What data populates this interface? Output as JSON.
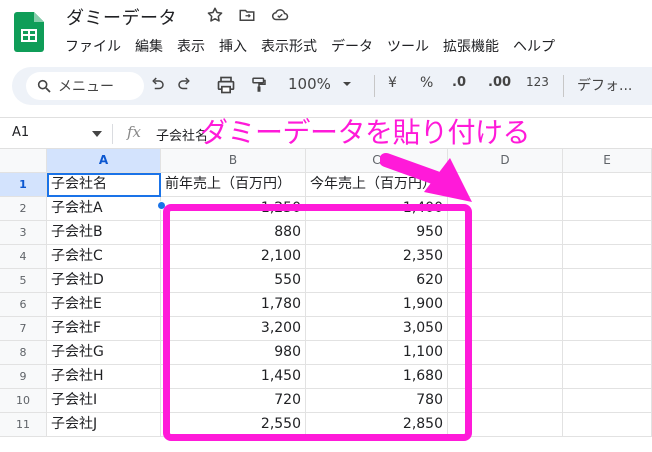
{
  "app": {
    "doc_title": "ダミーデータ",
    "menu": [
      "ファイル",
      "編集",
      "表示",
      "挿入",
      "表示形式",
      "データ",
      "ツール",
      "拡張機能",
      "ヘルプ"
    ]
  },
  "toolbar": {
    "menu_search_label": "メニュー",
    "zoom": "100%",
    "currency": "¥",
    "percent": "%",
    "decrease_decimal": ".0",
    "increase_decimal": ".00",
    "number_format": "123",
    "font": "デフォ..."
  },
  "formula_bar": {
    "cell_ref": "A1",
    "fx": "fx",
    "content": "子会社名"
  },
  "sheet": {
    "columns": [
      "A",
      "B",
      "C",
      "D",
      "E"
    ],
    "rows": [
      {
        "num": "1",
        "a": "子会社名",
        "b": "前年売上（百万円）",
        "c": "今年売上（百万円）"
      },
      {
        "num": "2",
        "a": "子会社A",
        "b": "1,250",
        "c": "1,400"
      },
      {
        "num": "3",
        "a": "子会社B",
        "b": "880",
        "c": "950"
      },
      {
        "num": "4",
        "a": "子会社C",
        "b": "2,100",
        "c": "2,350"
      },
      {
        "num": "5",
        "a": "子会社D",
        "b": "550",
        "c": "620"
      },
      {
        "num": "6",
        "a": "子会社E",
        "b": "1,780",
        "c": "1,900"
      },
      {
        "num": "7",
        "a": "子会社F",
        "b": "3,200",
        "c": "3,050"
      },
      {
        "num": "8",
        "a": "子会社G",
        "b": "980",
        "c": "1,100"
      },
      {
        "num": "9",
        "a": "子会社H",
        "b": "1,450",
        "c": "1,680"
      },
      {
        "num": "10",
        "a": "子会社I",
        "b": "720",
        "c": "780"
      },
      {
        "num": "11",
        "a": "子会社J",
        "b": "2,550",
        "c": "2,850"
      }
    ]
  },
  "annotation": {
    "text": "ダミーデータを貼り付ける",
    "color": "#ff1ad9"
  },
  "colors": {
    "accent": "#1a73e8",
    "selected_header": "#d3e3fd",
    "sheets_green": "#0f9d58"
  }
}
